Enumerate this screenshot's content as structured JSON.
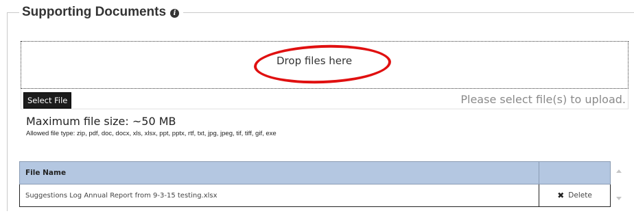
{
  "section": {
    "title": "Supporting Documents",
    "info_icon": "info-icon"
  },
  "dropzone": {
    "text": "Drop files here",
    "annotation_color": "#e01010"
  },
  "upload": {
    "select_button_label": "Select File",
    "status_text": "Please select file(s) to upload."
  },
  "limits": {
    "max_size": "Maximum file size: ~50 MB",
    "allowed_types": "Allowed file type: zip, pdf, doc, docx, xls, xlsx, ppt, pptx, rtf, txt, jpg, jpeg, tif, tiff, gif, exe"
  },
  "files_table": {
    "columns": [
      "File Name",
      ""
    ],
    "header_color": "#b4c7e1",
    "rows": [
      {
        "file_name": "Suggestions Log Annual Report from 9-3-15 testing.xlsx",
        "action_label": "Delete",
        "action_icon": "x-icon"
      }
    ]
  }
}
